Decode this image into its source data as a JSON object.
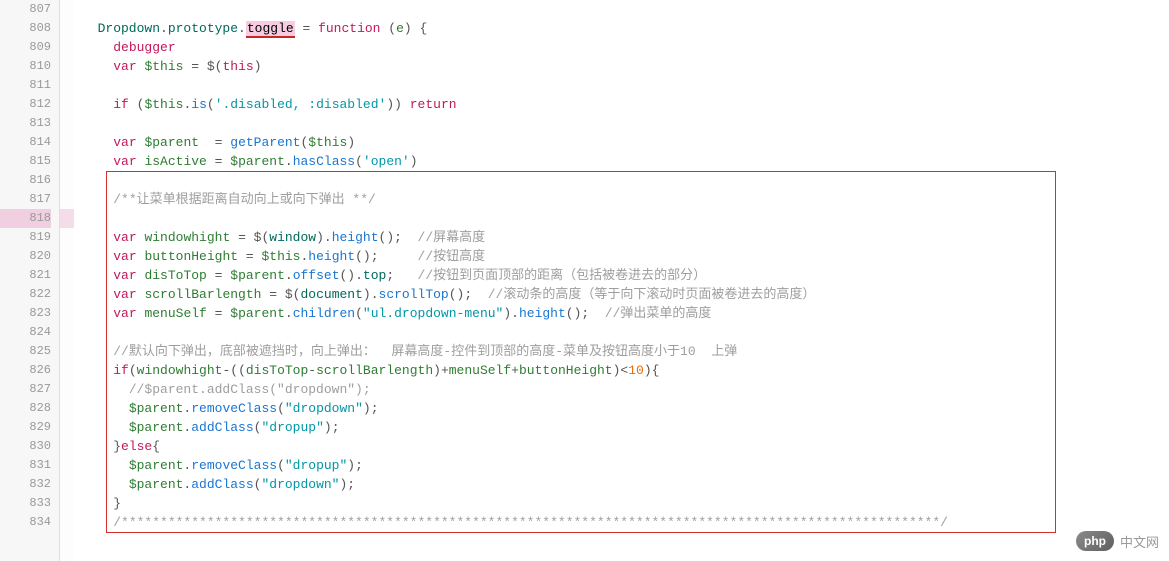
{
  "gutter": {
    "start": 807,
    "end": 834,
    "current": 818,
    "highlighted": 818
  },
  "code": {
    "807": "",
    "808_tokens": [
      {
        "t": "  Dropdown",
        "c": "ident"
      },
      {
        "t": ".",
        "c": "punc"
      },
      {
        "t": "prototype",
        "c": "ident"
      },
      {
        "t": ".",
        "c": "punc"
      },
      {
        "t": "toggle",
        "c": "hl-toggle"
      },
      {
        "t": " = ",
        "c": "punc"
      },
      {
        "t": "function",
        "c": "kw"
      },
      {
        "t": " (",
        "c": "punc"
      },
      {
        "t": "e",
        "c": "vn"
      },
      {
        "t": ") {",
        "c": "punc"
      }
    ],
    "809_tokens": [
      {
        "t": "    ",
        "c": ""
      },
      {
        "t": "debugger",
        "c": "kw"
      }
    ],
    "810_tokens": [
      {
        "t": "    ",
        "c": ""
      },
      {
        "t": "var",
        "c": "kw"
      },
      {
        "t": " ",
        "c": ""
      },
      {
        "t": "$this",
        "c": "vn"
      },
      {
        "t": " = $(",
        "c": "punc"
      },
      {
        "t": "this",
        "c": "kw"
      },
      {
        "t": ")",
        "c": "punc"
      }
    ],
    "811": "",
    "812_tokens": [
      {
        "t": "    ",
        "c": ""
      },
      {
        "t": "if",
        "c": "kw"
      },
      {
        "t": " (",
        "c": "punc"
      },
      {
        "t": "$this",
        "c": "vn"
      },
      {
        "t": ".",
        "c": "punc"
      },
      {
        "t": "is",
        "c": "fn"
      },
      {
        "t": "(",
        "c": "punc"
      },
      {
        "t": "'.disabled, :disabled'",
        "c": "str"
      },
      {
        "t": ")) ",
        "c": "punc"
      },
      {
        "t": "return",
        "c": "kw"
      }
    ],
    "813": "",
    "814_tokens": [
      {
        "t": "    ",
        "c": ""
      },
      {
        "t": "var",
        "c": "kw"
      },
      {
        "t": " ",
        "c": ""
      },
      {
        "t": "$parent",
        "c": "vn"
      },
      {
        "t": "  = ",
        "c": "punc"
      },
      {
        "t": "getParent",
        "c": "fn"
      },
      {
        "t": "(",
        "c": "punc"
      },
      {
        "t": "$this",
        "c": "vn"
      },
      {
        "t": ")",
        "c": "punc"
      }
    ],
    "815_tokens": [
      {
        "t": "    ",
        "c": ""
      },
      {
        "t": "var",
        "c": "kw"
      },
      {
        "t": " ",
        "c": ""
      },
      {
        "t": "isActive",
        "c": "vn"
      },
      {
        "t": " = ",
        "c": "punc"
      },
      {
        "t": "$parent",
        "c": "vn"
      },
      {
        "t": ".",
        "c": "punc"
      },
      {
        "t": "hasClass",
        "c": "fn"
      },
      {
        "t": "(",
        "c": "punc"
      },
      {
        "t": "'open'",
        "c": "str"
      },
      {
        "t": ")",
        "c": "punc"
      }
    ],
    "816": "",
    "817_tokens": [
      {
        "t": "    ",
        "c": ""
      },
      {
        "t": "/**让菜单根据距离自动向上或向下弹出 **/",
        "c": "cmt"
      }
    ],
    "818": "",
    "819_tokens": [
      {
        "t": "    ",
        "c": ""
      },
      {
        "t": "var",
        "c": "kw"
      },
      {
        "t": " ",
        "c": ""
      },
      {
        "t": "windowhight",
        "c": "vn"
      },
      {
        "t": " = $(",
        "c": "punc"
      },
      {
        "t": "window",
        "c": "ident"
      },
      {
        "t": ").",
        "c": "punc"
      },
      {
        "t": "height",
        "c": "fn"
      },
      {
        "t": "();  ",
        "c": "punc"
      },
      {
        "t": "//屏幕高度",
        "c": "cmt"
      }
    ],
    "820_tokens": [
      {
        "t": "    ",
        "c": ""
      },
      {
        "t": "var",
        "c": "kw"
      },
      {
        "t": " ",
        "c": ""
      },
      {
        "t": "buttonHeight",
        "c": "vn"
      },
      {
        "t": " = ",
        "c": "punc"
      },
      {
        "t": "$this",
        "c": "vn"
      },
      {
        "t": ".",
        "c": "punc"
      },
      {
        "t": "height",
        "c": "fn"
      },
      {
        "t": "();     ",
        "c": "punc"
      },
      {
        "t": "//按钮高度",
        "c": "cmt"
      }
    ],
    "821_tokens": [
      {
        "t": "    ",
        "c": ""
      },
      {
        "t": "var",
        "c": "kw"
      },
      {
        "t": " ",
        "c": ""
      },
      {
        "t": "disToTop",
        "c": "vn"
      },
      {
        "t": " = ",
        "c": "punc"
      },
      {
        "t": "$parent",
        "c": "vn"
      },
      {
        "t": ".",
        "c": "punc"
      },
      {
        "t": "offset",
        "c": "fn"
      },
      {
        "t": "().",
        "c": "punc"
      },
      {
        "t": "top",
        "c": "ident"
      },
      {
        "t": ";   ",
        "c": "punc"
      },
      {
        "t": "//按钮到页面顶部的距离（包括被卷进去的部分）",
        "c": "cmt"
      }
    ],
    "822_tokens": [
      {
        "t": "    ",
        "c": ""
      },
      {
        "t": "var",
        "c": "kw"
      },
      {
        "t": " ",
        "c": ""
      },
      {
        "t": "scrollBarlength",
        "c": "vn"
      },
      {
        "t": " = $(",
        "c": "punc"
      },
      {
        "t": "document",
        "c": "ident"
      },
      {
        "t": ").",
        "c": "punc"
      },
      {
        "t": "scrollTop",
        "c": "fn"
      },
      {
        "t": "();  ",
        "c": "punc"
      },
      {
        "t": "//滚动条的高度（等于向下滚动时页面被卷进去的高度）",
        "c": "cmt"
      }
    ],
    "823_tokens": [
      {
        "t": "    ",
        "c": ""
      },
      {
        "t": "var",
        "c": "kw"
      },
      {
        "t": " ",
        "c": ""
      },
      {
        "t": "menuSelf",
        "c": "vn"
      },
      {
        "t": " = ",
        "c": "punc"
      },
      {
        "t": "$parent",
        "c": "vn"
      },
      {
        "t": ".",
        "c": "punc"
      },
      {
        "t": "children",
        "c": "fn"
      },
      {
        "t": "(",
        "c": "punc"
      },
      {
        "t": "\"ul.dropdown-menu\"",
        "c": "str"
      },
      {
        "t": ").",
        "c": "punc"
      },
      {
        "t": "height",
        "c": "fn"
      },
      {
        "t": "();  ",
        "c": "punc"
      },
      {
        "t": "//弹出菜单的高度",
        "c": "cmt"
      }
    ],
    "824": "",
    "825_tokens": [
      {
        "t": "    ",
        "c": ""
      },
      {
        "t": "//默认向下弹出，底部被遮挡时，向上弹出：  屏幕高度-控件到顶部的高度-菜单及按钮高度小于10  上弹",
        "c": "cmt"
      }
    ],
    "826_tokens": [
      {
        "t": "    ",
        "c": ""
      },
      {
        "t": "if",
        "c": "kw"
      },
      {
        "t": "(",
        "c": "punc"
      },
      {
        "t": "windowhight",
        "c": "vn"
      },
      {
        "t": "-((",
        "c": "punc"
      },
      {
        "t": "disToTop",
        "c": "vn"
      },
      {
        "t": "-",
        "c": "punc"
      },
      {
        "t": "scrollBarlength",
        "c": "vn"
      },
      {
        "t": ")+",
        "c": "punc"
      },
      {
        "t": "menuSelf",
        "c": "vn"
      },
      {
        "t": "+",
        "c": "punc"
      },
      {
        "t": "buttonHeight",
        "c": "vn"
      },
      {
        "t": ")<",
        "c": "punc"
      },
      {
        "t": "10",
        "c": "num"
      },
      {
        "t": "){",
        "c": "punc"
      }
    ],
    "827_tokens": [
      {
        "t": "      ",
        "c": ""
      },
      {
        "t": "//$parent.addClass(\"dropdown\");",
        "c": "cmt"
      }
    ],
    "828_tokens": [
      {
        "t": "      ",
        "c": ""
      },
      {
        "t": "$parent",
        "c": "vn"
      },
      {
        "t": ".",
        "c": "punc"
      },
      {
        "t": "removeClass",
        "c": "fn"
      },
      {
        "t": "(",
        "c": "punc"
      },
      {
        "t": "\"dropdown\"",
        "c": "str"
      },
      {
        "t": ");",
        "c": "punc"
      }
    ],
    "829_tokens": [
      {
        "t": "      ",
        "c": ""
      },
      {
        "t": "$parent",
        "c": "vn"
      },
      {
        "t": ".",
        "c": "punc"
      },
      {
        "t": "addClass",
        "c": "fn"
      },
      {
        "t": "(",
        "c": "punc"
      },
      {
        "t": "\"dropup\"",
        "c": "str"
      },
      {
        "t": ");",
        "c": "punc"
      }
    ],
    "830_tokens": [
      {
        "t": "    }",
        "c": "punc"
      },
      {
        "t": "else",
        "c": "kw"
      },
      {
        "t": "{",
        "c": "punc"
      }
    ],
    "831_tokens": [
      {
        "t": "      ",
        "c": ""
      },
      {
        "t": "$parent",
        "c": "vn"
      },
      {
        "t": ".",
        "c": "punc"
      },
      {
        "t": "removeClass",
        "c": "fn"
      },
      {
        "t": "(",
        "c": "punc"
      },
      {
        "t": "\"dropup\"",
        "c": "str"
      },
      {
        "t": ");",
        "c": "punc"
      }
    ],
    "832_tokens": [
      {
        "t": "      ",
        "c": ""
      },
      {
        "t": "$parent",
        "c": "vn"
      },
      {
        "t": ".",
        "c": "punc"
      },
      {
        "t": "addClass",
        "c": "fn"
      },
      {
        "t": "(",
        "c": "punc"
      },
      {
        "t": "\"dropdown\"",
        "c": "str"
      },
      {
        "t": ");",
        "c": "punc"
      }
    ],
    "833_tokens": [
      {
        "t": "    }",
        "c": "punc"
      }
    ],
    "834_tokens": [
      {
        "t": "    ",
        "c": ""
      },
      {
        "t": "/*********************************************************************************************************/",
        "c": "cmt"
      }
    ]
  },
  "watermark": {
    "badge": "php",
    "text": "中文网"
  }
}
